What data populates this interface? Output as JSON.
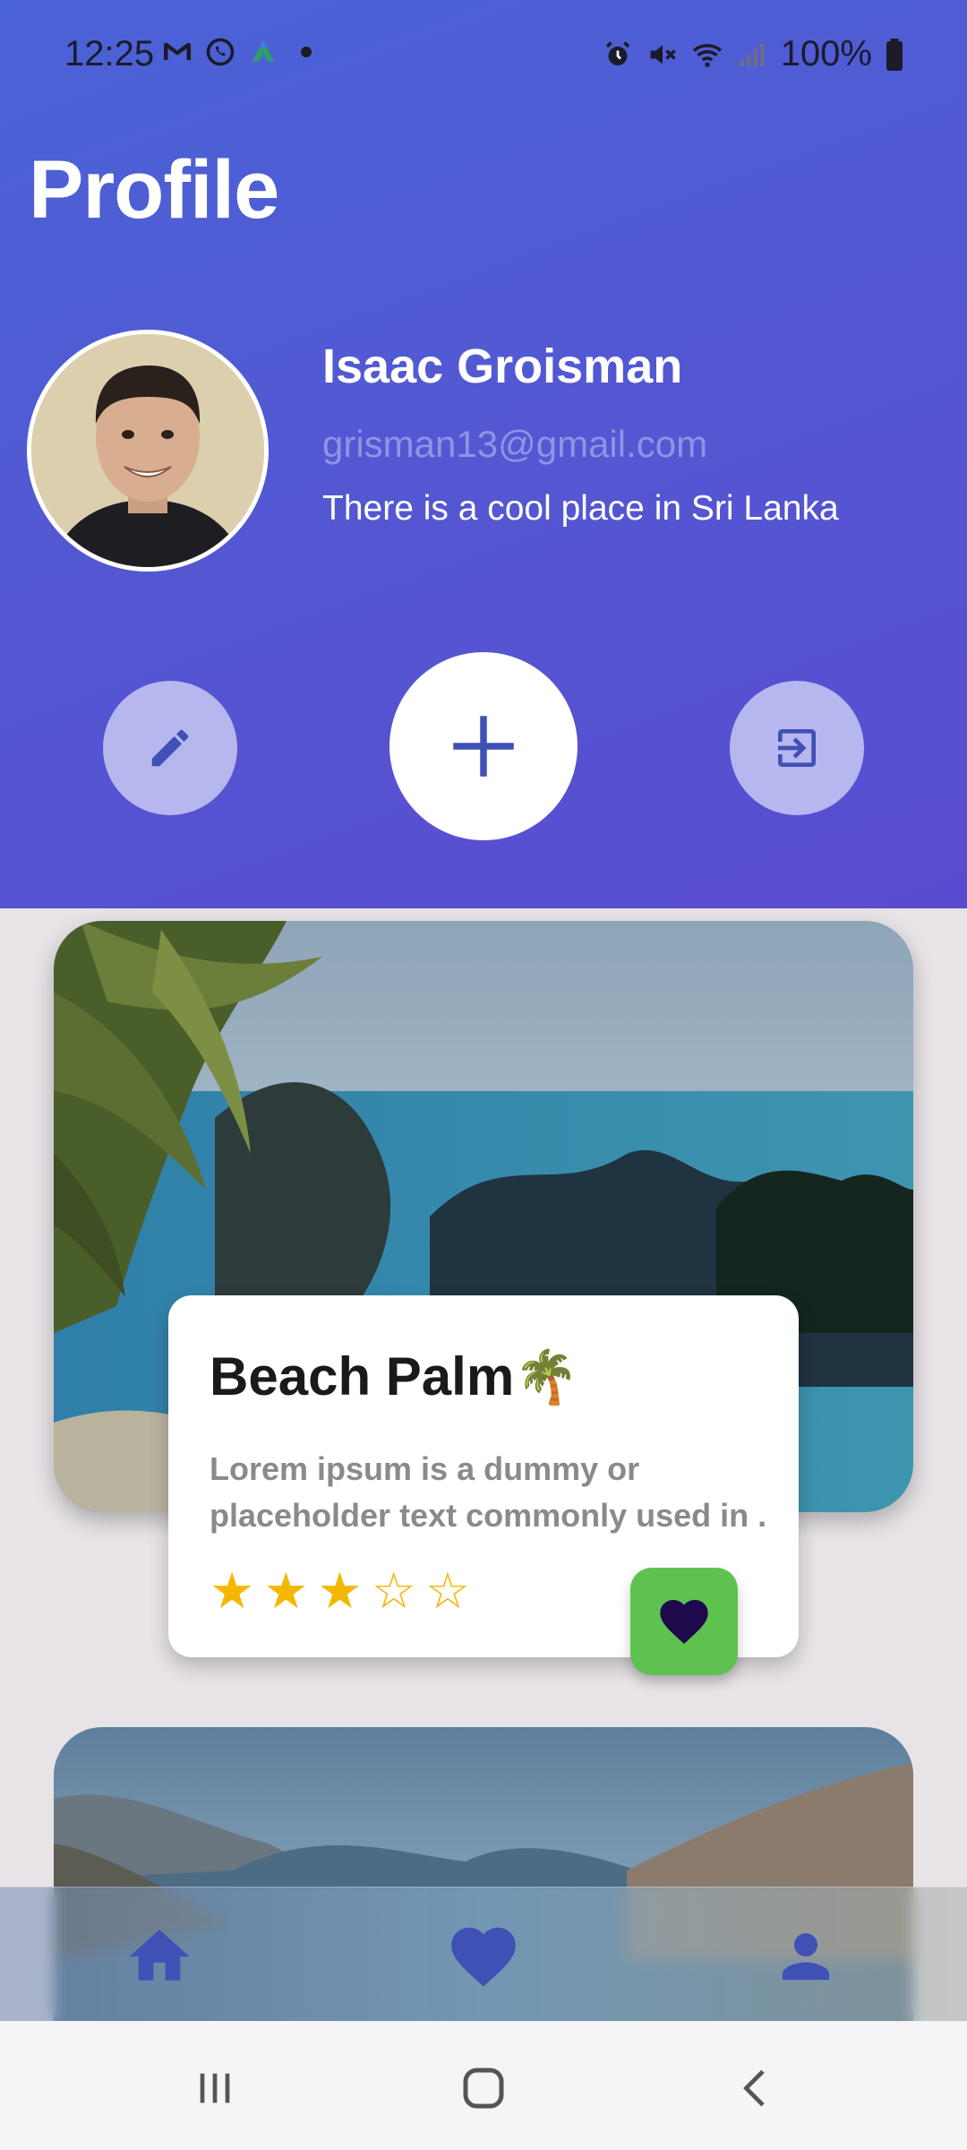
{
  "status_bar": {
    "time": "12:25",
    "battery": "100%",
    "left_icons": [
      "gmail-icon",
      "whatsapp-icon",
      "app-icon",
      "dot-icon"
    ],
    "right_icons": [
      "alarm-icon",
      "mute-icon",
      "wifi-icon",
      "signal-icon",
      "battery-icon"
    ]
  },
  "header": {
    "title": "Profile",
    "background_color": "#5456d2"
  },
  "profile": {
    "name": "Isaac Groisman",
    "email": "grisman13@gmail.com",
    "bio": "There is a cool place in Sri Lanka"
  },
  "actions": {
    "edit_icon": "pencil-icon",
    "add_icon": "plus-icon",
    "logout_icon": "exit-icon",
    "accent_color": "#3f51b5"
  },
  "feed": {
    "items": [
      {
        "title": "Beach Palm",
        "emoji": "🌴",
        "description_line1": "Lorem ipsum is a dummy or",
        "description_line2": "placeholder text commonly used in ...",
        "rating": 3,
        "max_rating": 5,
        "star_filled": "★",
        "star_empty": "☆",
        "favorite_color": "#5ec24f"
      }
    ]
  },
  "bottom_nav": {
    "items": [
      "home-icon",
      "heart-icon",
      "person-icon"
    ],
    "active_color": "#3f51b5"
  }
}
